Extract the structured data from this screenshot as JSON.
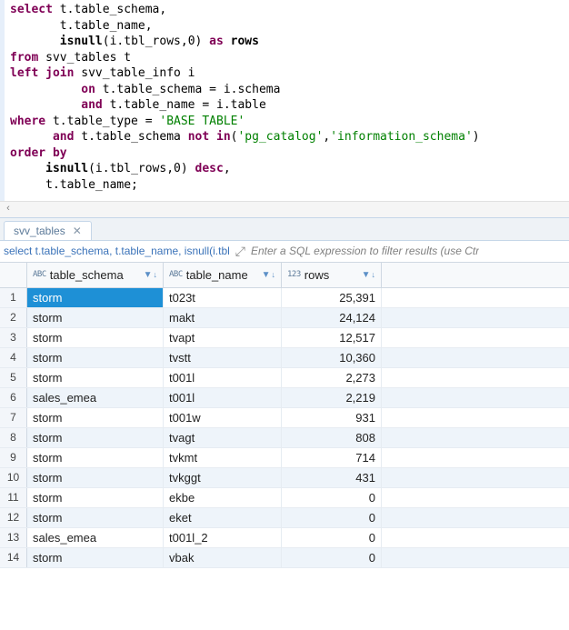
{
  "sql": {
    "tokens": [
      [
        [
          "kw",
          "select"
        ],
        [
          "id",
          " t.table_schema,"
        ]
      ],
      [
        [
          "id",
          "       t.table_name,"
        ]
      ],
      [
        [
          "id",
          "       "
        ],
        [
          "fn",
          "isnull"
        ],
        [
          "id",
          "(i.tbl_rows,"
        ],
        [
          "num",
          "0"
        ],
        [
          "id",
          ") "
        ],
        [
          "kw",
          "as"
        ],
        [
          "id",
          " "
        ],
        [
          "fn",
          "rows"
        ]
      ],
      [
        [
          "kw",
          "from"
        ],
        [
          "id",
          " svv_tables t"
        ]
      ],
      [
        [
          "kw",
          "left"
        ],
        [
          "id",
          " "
        ],
        [
          "kw",
          "join"
        ],
        [
          "id",
          " svv_table_info i"
        ]
      ],
      [
        [
          "id",
          "          "
        ],
        [
          "kw",
          "on"
        ],
        [
          "id",
          " t.table_schema = i.schema"
        ]
      ],
      [
        [
          "id",
          "          "
        ],
        [
          "kw",
          "and"
        ],
        [
          "id",
          " t.table_name = i.table"
        ]
      ],
      [
        [
          "kw",
          "where"
        ],
        [
          "id",
          " t.table_type = "
        ],
        [
          "str",
          "'BASE TABLE'"
        ]
      ],
      [
        [
          "id",
          "      "
        ],
        [
          "kw",
          "and"
        ],
        [
          "id",
          " t.table_schema "
        ],
        [
          "kw",
          "not"
        ],
        [
          "id",
          " "
        ],
        [
          "kw",
          "in"
        ],
        [
          "id",
          "("
        ],
        [
          "str",
          "'pg_catalog'"
        ],
        [
          "id",
          ","
        ],
        [
          "str",
          "'information_schema'"
        ],
        [
          "id",
          ")"
        ]
      ],
      [
        [
          "kw",
          "order"
        ],
        [
          "id",
          " "
        ],
        [
          "kw",
          "by"
        ]
      ],
      [
        [
          "id",
          "     "
        ],
        [
          "fn",
          "isnull"
        ],
        [
          "id",
          "(i.tbl_rows,"
        ],
        [
          "num",
          "0"
        ],
        [
          "id",
          ") "
        ],
        [
          "kw",
          "desc"
        ],
        [
          "id",
          ","
        ]
      ],
      [
        [
          "id",
          "     t.table_name;"
        ]
      ]
    ]
  },
  "tab": {
    "label": "svv_tables"
  },
  "filter": {
    "sql_truncated": "select t.table_schema, t.table_name, isnull(i.tbl",
    "hint": "Enter a SQL expression to filter results (use Ctr"
  },
  "columns": {
    "schema": {
      "type_prefix": "ABC",
      "label": "table_schema"
    },
    "name": {
      "type_prefix": "ABC",
      "label": "table_name"
    },
    "rows": {
      "type_prefix": "123",
      "label": "rows"
    }
  },
  "rows": [
    {
      "n": 1,
      "schema": "storm",
      "name": "t023t",
      "rows": "25,391",
      "selected": true
    },
    {
      "n": 2,
      "schema": "storm",
      "name": "makt",
      "rows": "24,124"
    },
    {
      "n": 3,
      "schema": "storm",
      "name": "tvapt",
      "rows": "12,517"
    },
    {
      "n": 4,
      "schema": "storm",
      "name": "tvstt",
      "rows": "10,360"
    },
    {
      "n": 5,
      "schema": "storm",
      "name": "t001l",
      "rows": "2,273"
    },
    {
      "n": 6,
      "schema": "sales_emea",
      "name": "t001l",
      "rows": "2,219"
    },
    {
      "n": 7,
      "schema": "storm",
      "name": "t001w",
      "rows": "931"
    },
    {
      "n": 8,
      "schema": "storm",
      "name": "tvagt",
      "rows": "808"
    },
    {
      "n": 9,
      "schema": "storm",
      "name": "tvkmt",
      "rows": "714"
    },
    {
      "n": 10,
      "schema": "storm",
      "name": "tvkggt",
      "rows": "431"
    },
    {
      "n": 11,
      "schema": "storm",
      "name": "ekbe",
      "rows": "0"
    },
    {
      "n": 12,
      "schema": "storm",
      "name": "eket",
      "rows": "0"
    },
    {
      "n": 13,
      "schema": "sales_emea",
      "name": "t001l_2",
      "rows": "0"
    },
    {
      "n": 14,
      "schema": "storm",
      "name": "vbak",
      "rows": "0"
    }
  ],
  "icons": {
    "funnel": "▼",
    "sort_asc": "↑",
    "sort_desc": "↓",
    "expand": "⤢",
    "close": "✕",
    "scroll_left": "‹"
  }
}
